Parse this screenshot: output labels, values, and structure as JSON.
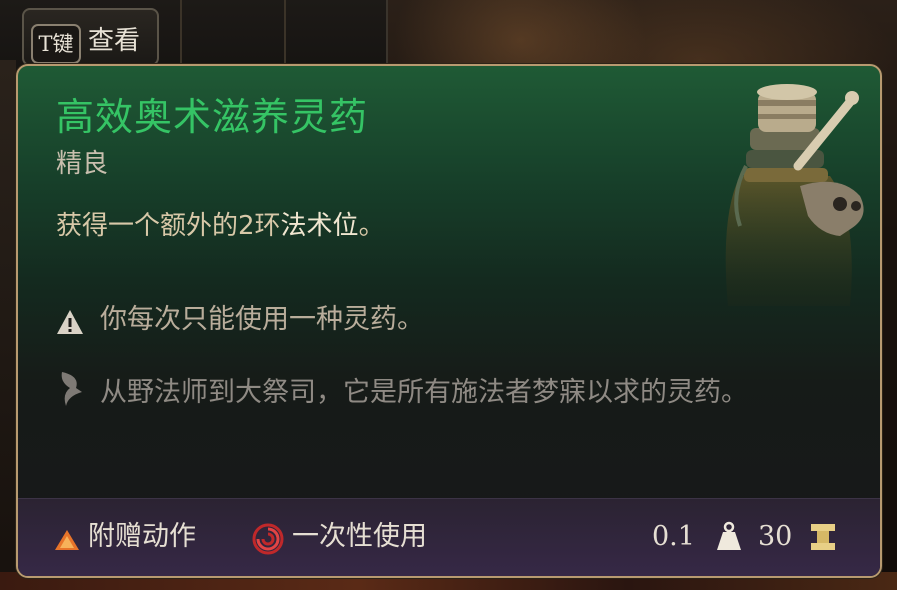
{
  "key_hint": {
    "key": "T键",
    "label": "查看"
  },
  "tooltip": {
    "title": "高效奥术滋养灵药",
    "rarity": "精良",
    "description_prefix": "获得一个额外的2环",
    "description_highlight": "法术位",
    "description_suffix": "。",
    "warning": "你每次只能使用一种灵药。",
    "lore": "从野法师到大祭司，它是所有施法者梦寐以求的灵药。",
    "footer": {
      "action_type": "附赠动作",
      "usage": "一次性使用",
      "weight": "0.1",
      "value": "30"
    }
  },
  "colors": {
    "title_green": "#35c465",
    "border_gold": "#b89a70",
    "action_orange": "#e8742a",
    "usage_red": "#c0282a"
  },
  "icons": {
    "warning": "warning-triangle-icon",
    "lore": "quill-icon",
    "action": "bonus-action-triangle-icon",
    "usage": "single-use-swirl-icon",
    "weight": "weight-icon",
    "value": "gold-coin-icon"
  }
}
